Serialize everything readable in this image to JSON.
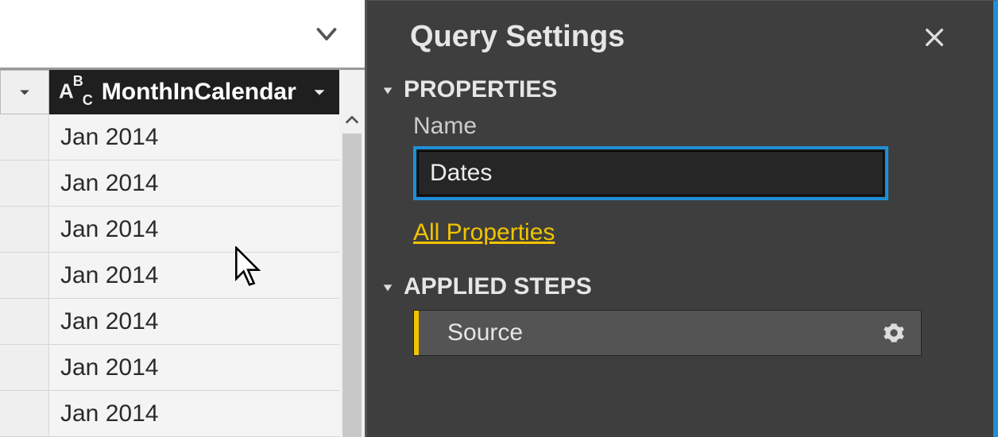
{
  "header": {
    "title": "Query Settings"
  },
  "column": {
    "type_badge_a": "A",
    "type_badge_b": "B",
    "type_badge_c": "C",
    "name": "MonthInCalendar"
  },
  "rows": [
    "Jan 2014",
    "Jan 2014",
    "Jan 2014",
    "Jan 2014",
    "Jan 2014",
    "Jan 2014",
    "Jan 2014"
  ],
  "properties": {
    "section_label": "PROPERTIES",
    "name_label": "Name",
    "name_value": "Dates",
    "all_properties": "All Properties"
  },
  "applied_steps": {
    "section_label": "APPLIED STEPS",
    "steps": [
      {
        "name": "Source"
      }
    ]
  },
  "colors": {
    "accent_blue": "#1f8fd6",
    "accent_yellow": "#f0c400"
  }
}
